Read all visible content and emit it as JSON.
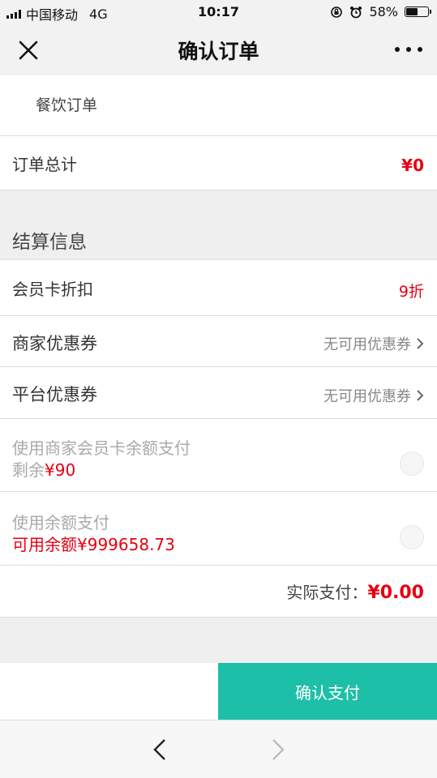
{
  "status_bar": {
    "carrier": "中国移动",
    "network": "4G",
    "time": "10:17",
    "battery": "58%",
    "battery_level": 0.58
  },
  "nav": {
    "title": "确认订单"
  },
  "order": {
    "category": "餐饮订单",
    "total_label": "订单总计",
    "total_value": "¥0"
  },
  "settlement": {
    "section_title": "结算信息",
    "member_discount_label": "会员卡折扣",
    "member_discount_value": "9折",
    "merchant_coupon_label": "商家优惠券",
    "merchant_coupon_value": "无可用优惠券",
    "platform_coupon_label": "平台优惠券",
    "platform_coupon_value": "无可用优惠券",
    "card_balance_label": "使用商家会员卡余额支付",
    "card_balance_remaining_prefix": "剩余",
    "card_balance_remaining_value": "¥90",
    "balance_label": "使用余额支付",
    "balance_available": "可用余额¥999658.73",
    "actual_pay_label": "实际支付：",
    "actual_pay_value": "¥0.00"
  },
  "bottom": {
    "pay_button": "确认支付"
  },
  "colors": {
    "accent": "#1ebfa8",
    "price_red": "#e60012"
  }
}
